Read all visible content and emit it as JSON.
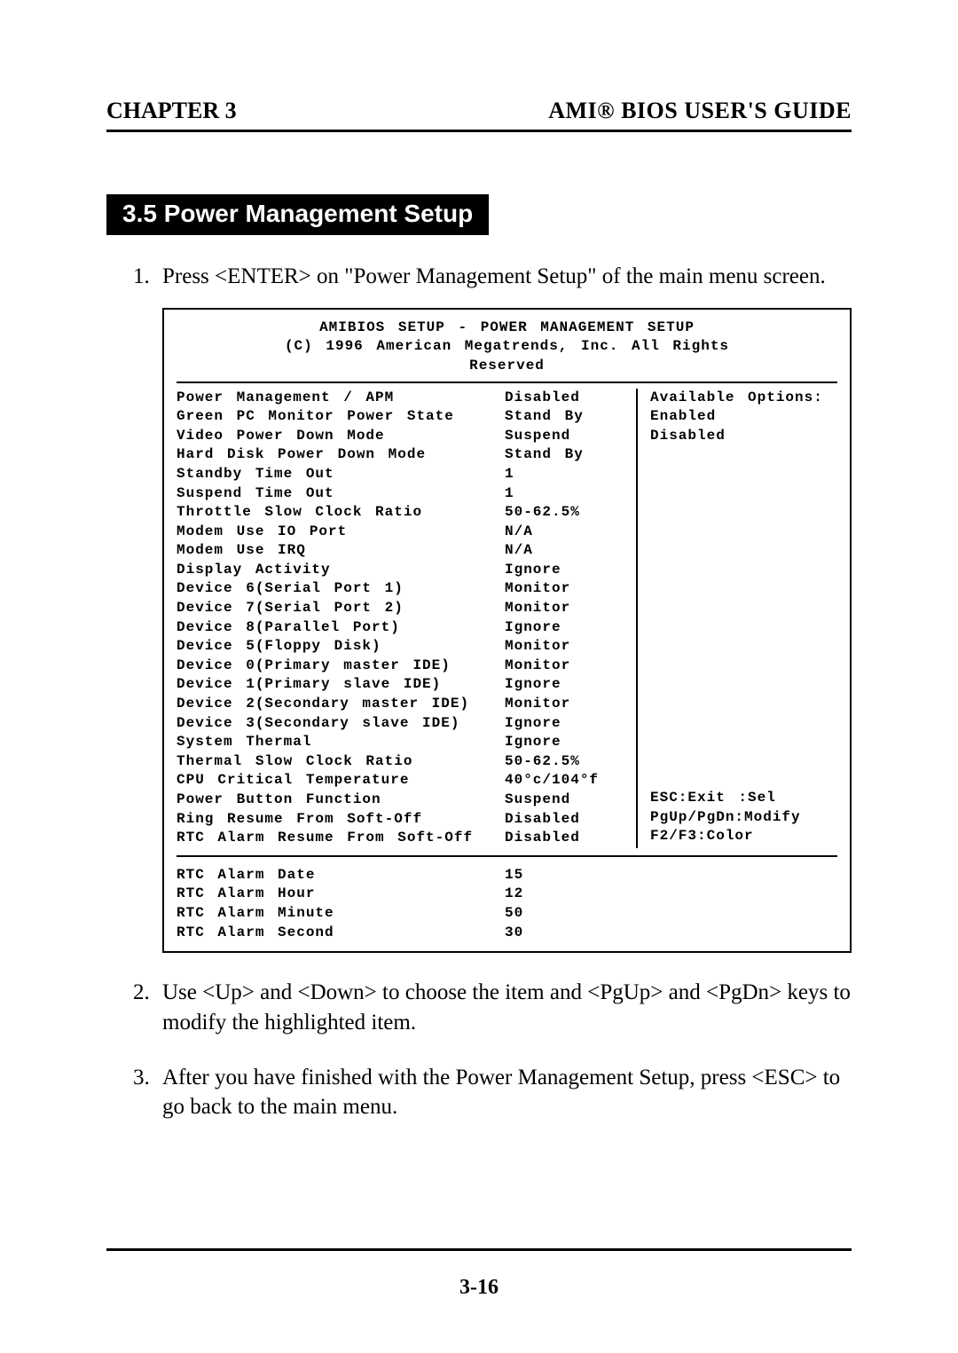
{
  "header": {
    "chapter": "CHAPTER 3",
    "guide": "AMI® BIOS USER'S GUIDE"
  },
  "section": {
    "title": "3.5 Power Management Setup"
  },
  "instructions": {
    "step1": "Press <ENTER> on \"Power Management Setup\" of the main menu screen.",
    "step2": "Use <Up> and <Down> to choose the item and <PgUp> and <PgDn> keys to modify the highlighted item.",
    "step3": "After you have finished with the Power Management Setup, press <ESC> to go back to the main menu."
  },
  "bios": {
    "title_line1": "AMIBIOS SETUP - POWER MANAGEMENT SETUP",
    "title_line2": "(C) 1996 American Megatrends, Inc. All Rights",
    "title_line3": "Reserved",
    "items": [
      {
        "label": "Power Management / APM",
        "value": "Disabled"
      },
      {
        "label": "Green PC Monitor Power State",
        "value": "Stand By"
      },
      {
        "label": "Video Power Down Mode",
        "value": "Suspend"
      },
      {
        "label": "Hard Disk Power Down Mode",
        "value": "Stand By"
      },
      {
        "label": "Standby Time Out",
        "value": "1"
      },
      {
        "label": "Suspend Time Out",
        "value": "1"
      },
      {
        "label": "Throttle Slow Clock Ratio",
        "value": "50-62.5%"
      },
      {
        "label": "Modem Use IO Port",
        "value": "N/A"
      },
      {
        "label": "Modem Use IRQ",
        "value": "N/A"
      },
      {
        "label": "Display Activity",
        "value": "Ignore"
      },
      {
        "label": "Device 6(Serial Port 1)",
        "value": "Monitor"
      },
      {
        "label": "Device 7(Serial Port 2)",
        "value": "Monitor"
      },
      {
        "label": "Device 8(Parallel Port)",
        "value": "Ignore"
      },
      {
        "label": "Device 5(Floppy Disk)",
        "value": "Monitor"
      },
      {
        "label": "Device 0(Primary master IDE)",
        "value": "Monitor"
      },
      {
        "label": "Device 1(Primary slave IDE)",
        "value": "Ignore"
      },
      {
        "label": "Device 2(Secondary master IDE)",
        "value": "Monitor"
      },
      {
        "label": "Device 3(Secondary slave IDE)",
        "value": "Ignore"
      },
      {
        "label": "System Thermal",
        "value": "Ignore"
      },
      {
        "label": "Thermal Slow Clock Ratio",
        "value": "50-62.5%"
      },
      {
        "label": "CPU Critical Temperature",
        "value": "40°c/104°f"
      },
      {
        "label": "Power Button Function",
        "value": "Suspend"
      },
      {
        "label": "Ring Resume From Soft-Off",
        "value": "Disabled"
      },
      {
        "label": "RTC Alarm Resume From Soft-Off",
        "value": "Disabled"
      }
    ],
    "side_top": {
      "line1": "Available Options:",
      "line2": "Enabled",
      "line3": "Disabled"
    },
    "side_bottom": {
      "line1": "ESC:Exit :Sel",
      "line2": "PgUp/PgDn:Modify",
      "line3": "F2/F3:Color"
    },
    "rtc": [
      {
        "label": "RTC Alarm Date",
        "value": "15"
      },
      {
        "label": "RTC Alarm Hour",
        "value": "12"
      },
      {
        "label": "RTC Alarm Minute",
        "value": "50"
      },
      {
        "label": "RTC Alarm Second",
        "value": "30"
      }
    ]
  },
  "page_number": "3-16"
}
